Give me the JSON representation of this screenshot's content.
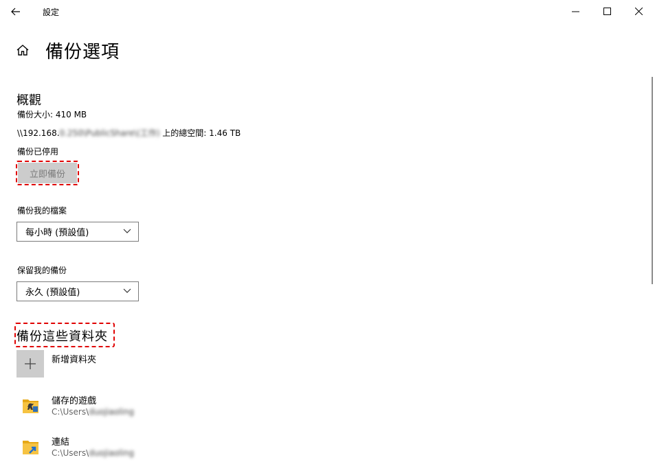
{
  "window": {
    "title": "設定",
    "minimize": "—",
    "maximize": "☐",
    "close": "✕"
  },
  "page": {
    "title": "備份選項"
  },
  "overview": {
    "heading": "概觀",
    "backup_size": "備份大小: 410 MB",
    "location_prefix": "\\\\192.168.",
    "location_blurred": "0.250\\PublicShare\\(工作)",
    "location_suffix": " 上的總空間: 1.46 TB",
    "status": "備份已停用",
    "backup_now_label": "立即備份"
  },
  "backup_frequency": {
    "label": "備份我的檔案",
    "selected": "每小時 (預設值)"
  },
  "keep_backups": {
    "label": "保留我的備份",
    "selected": "永久 (預設值)"
  },
  "folders": {
    "heading": "備份這些資料夾",
    "add_label": "新增資料夾",
    "items": [
      {
        "name": "儲存的遊戲",
        "path_prefix": "C:\\Users\\",
        "path_blurred": "duojiaoling",
        "icon": "saved-games-folder-icon"
      },
      {
        "name": "連結",
        "path_prefix": "C:\\Users\\",
        "path_blurred": "duojiaoling",
        "icon": "links-folder-icon"
      }
    ]
  },
  "colors": {
    "highlight": "#e00000",
    "disabled_button": "#cccccc",
    "folder": "#f6c342"
  }
}
